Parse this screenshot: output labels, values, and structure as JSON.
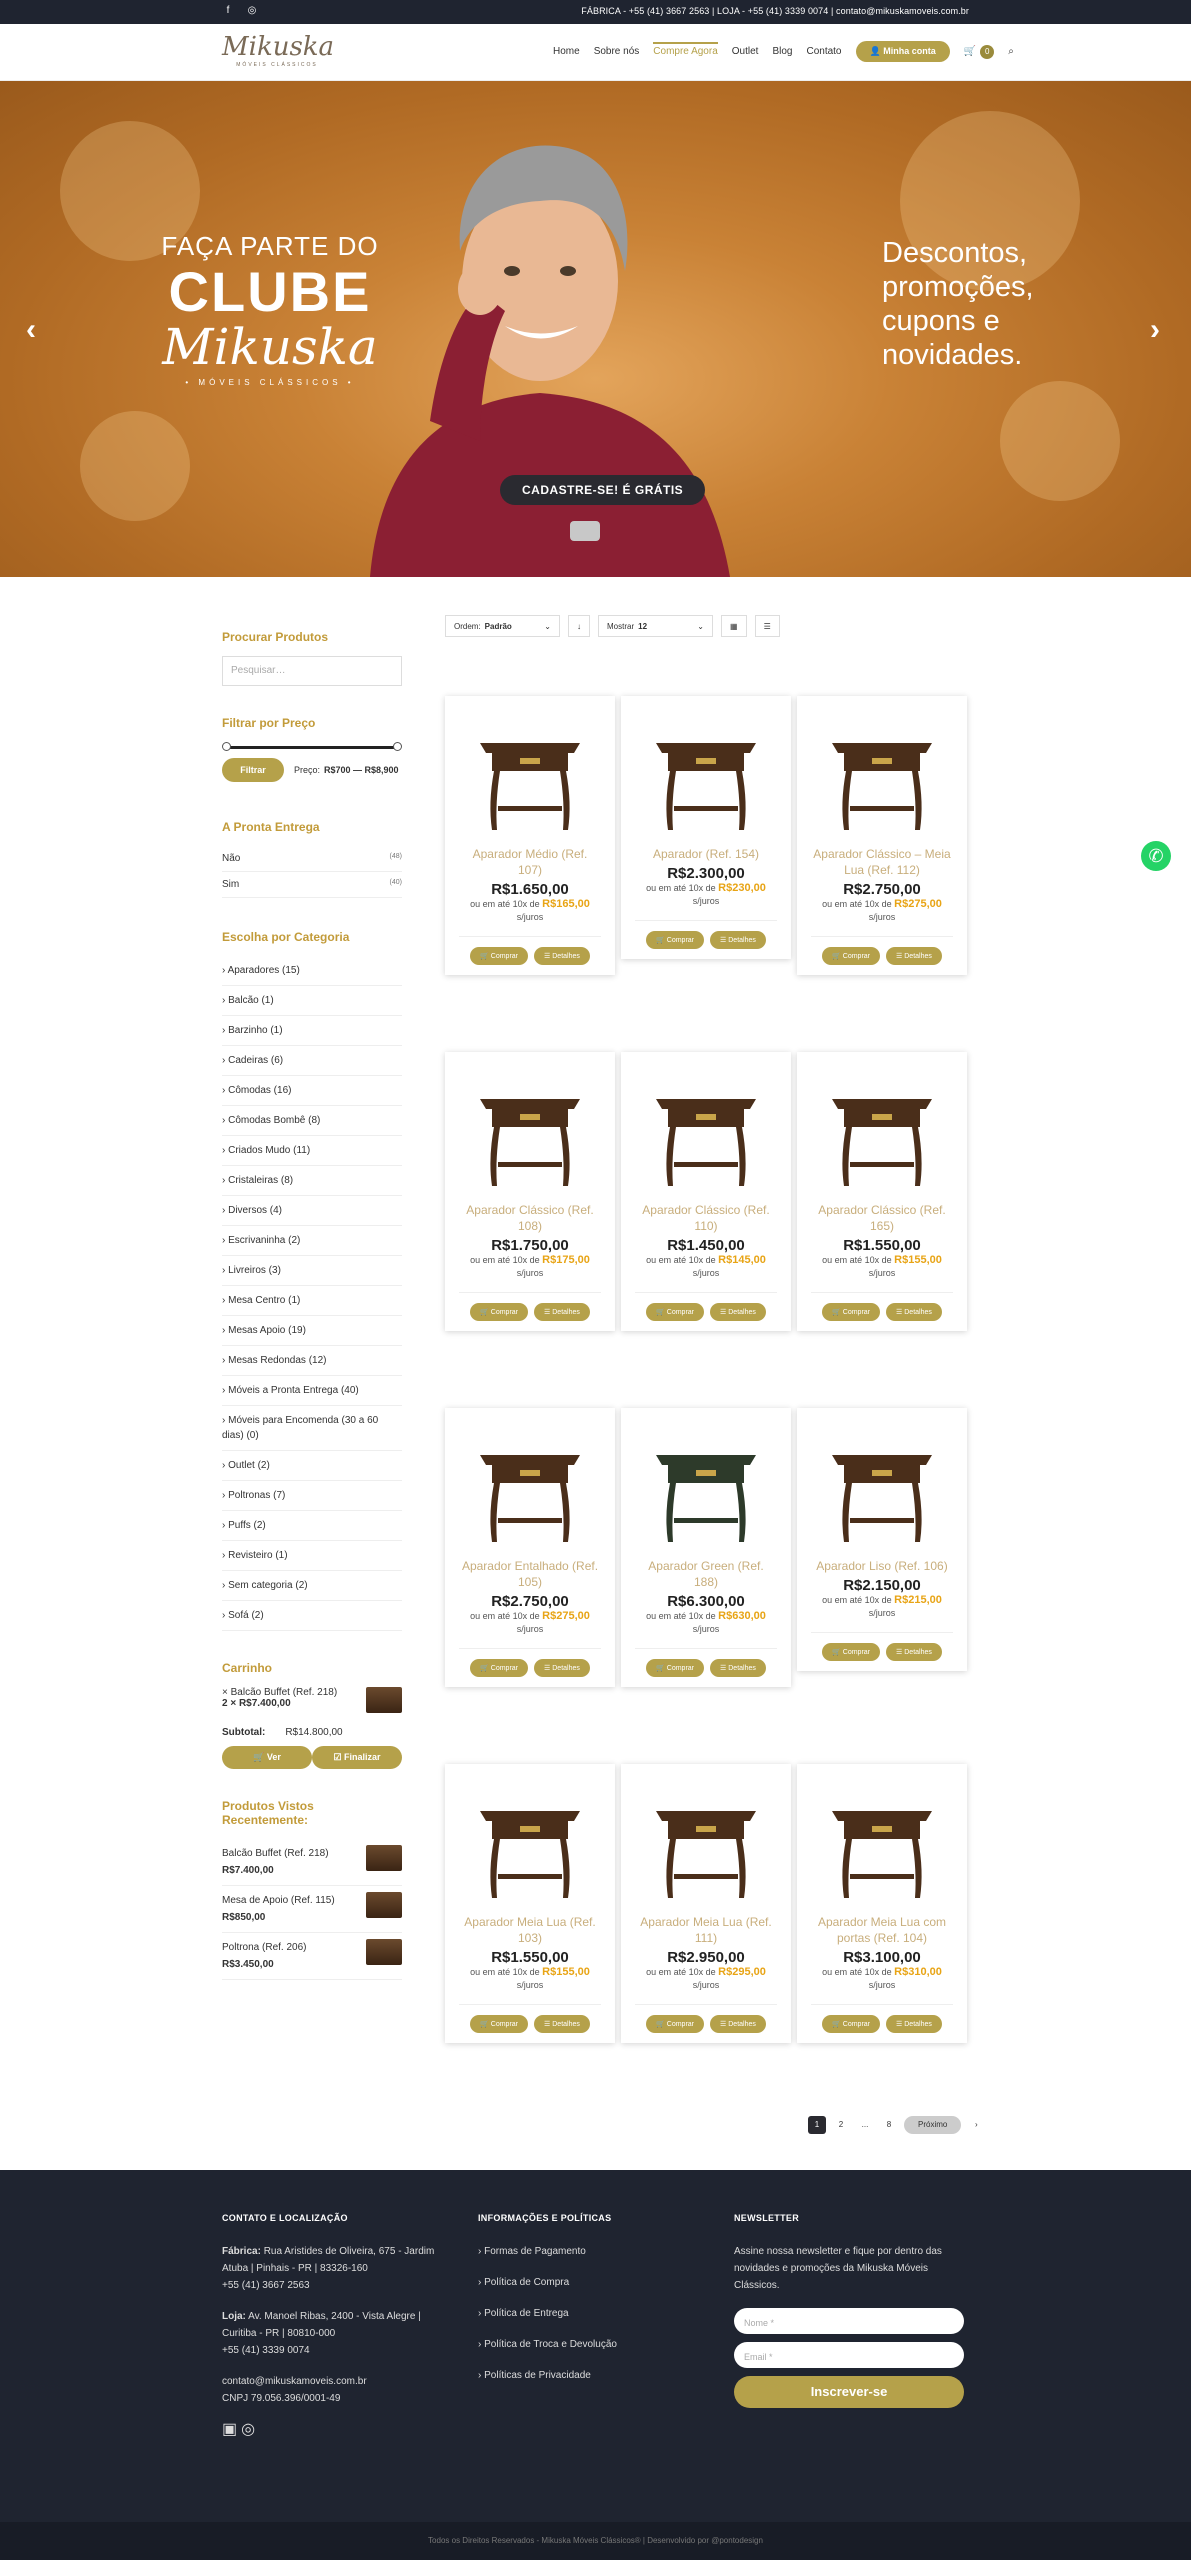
{
  "topbar": {
    "contact": "FÁBRICA - +55 (41) 3667 2563 | LOJA - +55 (41) 3339 0074 | contato@mikuskamoveis.com.br",
    "social": [
      "facebook-icon",
      "instagram-icon"
    ]
  },
  "header": {
    "logo": "Mikuska",
    "logo_sub": "MÓVEIS CLÁSSICOS",
    "nav": [
      "Home",
      "Sobre nós",
      "Compre Agora",
      "Outlet",
      "Blog",
      "Contato"
    ],
    "account": "Minha conta",
    "cart_count": "0"
  },
  "hero": {
    "line1": "FAÇA PARTE DO",
    "line2": "CLUBE",
    "line3": "Mikuska",
    "line4": "• MÓVEIS CLÁSSICOS •",
    "promo": [
      "Descontos,",
      "promoções,",
      "cupons e",
      "novidades."
    ],
    "cta_a": "CADASTRE-SE!",
    "cta_b": "É GRÁTIS"
  },
  "sidebar": {
    "search_title": "Procurar Produtos",
    "search_placeholder": "Pesquisar…",
    "price_title": "Filtrar por Preço",
    "filter_btn": "Filtrar",
    "price_label": "Preço:",
    "price_range": "R$700 — R$8,900",
    "ready_title": "A Pronta Entrega",
    "ready": [
      {
        "label": "Não",
        "count": "(48)"
      },
      {
        "label": "Sim",
        "count": "(40)"
      }
    ],
    "cat_title": "Escolha por Categoria",
    "categories": [
      "Aparadores (15)",
      "Balcão (1)",
      "Barzinho (1)",
      "Cadeiras (6)",
      "Cômodas (16)",
      "Cômodas Bombê (8)",
      "Criados Mudo (11)",
      "Cristaleiras (8)",
      "Diversos (4)",
      "Escrivaninha (2)",
      "Livreiros (3)",
      "Mesa Centro (1)",
      "Mesas Apoio (19)",
      "Mesas Redondas (12)",
      "Móveis a Pronta Entrega (40)",
      "Móveis para Encomenda (30 a 60 dias) (0)",
      "Outlet (2)",
      "Poltronas (7)",
      "Puffs (2)",
      "Revisteiro (1)",
      "Sem categoria (2)",
      "Sofá (2)"
    ],
    "cart_title": "Carrinho",
    "cart_item": "× Balcão Buffet (Ref. 218)",
    "cart_qty": "2 × R$7.400,00",
    "subtotal_label": "Subtotal:",
    "subtotal": "R$14.800,00",
    "btn_view": "Ver",
    "btn_finish": "Finalizar",
    "recent_title": "Produtos Vistos Recentemente:",
    "recent": [
      {
        "name": "Balcão Buffet (Ref. 218)",
        "price": "R$7.400,00"
      },
      {
        "name": "Mesa de Apoio (Ref. 115)",
        "price": "R$850,00"
      },
      {
        "name": "Poltrona (Ref. 206)",
        "price": "R$3.450,00"
      }
    ]
  },
  "toolbar": {
    "order_label": "Ordem:",
    "order": "Padrão",
    "show_label": "Mostrar",
    "show": "12"
  },
  "products": [
    {
      "name": "Aparador Médio (Ref. 107)",
      "price": "R$1.650,00",
      "inst": "R$165,00"
    },
    {
      "name": "Aparador (Ref. 154)",
      "price": "R$2.300,00",
      "inst": "R$230,00"
    },
    {
      "name": "Aparador Clássico – Meia Lua (Ref. 112)",
      "price": "R$2.750,00",
      "inst": "R$275,00"
    },
    {
      "name": "Aparador Clássico (Ref. 108)",
      "price": "R$1.750,00",
      "inst": "R$175,00"
    },
    {
      "name": "Aparador Clássico (Ref. 110)",
      "price": "R$1.450,00",
      "inst": "R$145,00"
    },
    {
      "name": "Aparador Clássico (Ref. 165)",
      "price": "R$1.550,00",
      "inst": "R$155,00"
    },
    {
      "name": "Aparador Entalhado (Ref. 105)",
      "price": "R$2.750,00",
      "inst": "R$275,00"
    },
    {
      "name": "Aparador Green (Ref. 188)",
      "price": "R$6.300,00",
      "inst": "R$630,00"
    },
    {
      "name": "Aparador Liso (Ref. 106)",
      "price": "R$2.150,00",
      "inst": "R$215,00"
    },
    {
      "name": "Aparador Meia Lua (Ref. 103)",
      "price": "R$1.550,00",
      "inst": "R$155,00"
    },
    {
      "name": "Aparador Meia Lua (Ref. 111)",
      "price": "R$2.950,00",
      "inst": "R$295,00"
    },
    {
      "name": "Aparador Meia Lua com portas (Ref. 104)",
      "price": "R$3.100,00",
      "inst": "R$310,00"
    }
  ],
  "card_text": {
    "inst_pre": "ou em até 10x de",
    "inst_post": "s/juros",
    "buy": "Comprar",
    "details": "Detalhes"
  },
  "pagination": [
    "1",
    "2",
    "...",
    "8",
    "Próximo",
    "›"
  ],
  "footer": {
    "col1_title": "CONTATO E LOCALIZAÇÃO",
    "factory_label": "Fábrica:",
    "factory": "Rua Aristides de Oliveira, 675 - Jardim Atuba | Pinhais - PR | 83326-160",
    "factory_phone": "+55 (41) 3667 2563",
    "store_label": "Loja:",
    "store": "Av. Manoel Ribas, 2400 - Vista Alegre | Curitiba - PR | 80810-000",
    "store_phone": "+55 (41) 3339 0074",
    "email": "contato@mikuskamoveis.com.br",
    "cnpj": "CNPJ 79.056.396/0001-49",
    "col2_title": "INFORMAÇÕES E POLÍTICAS",
    "links": [
      "Formas de Pagamento",
      "Política de Compra",
      "Política de Entrega",
      "Política de Troca e Devolução",
      "Políticas de Privacidade"
    ],
    "col3_title": "NEWSLETTER",
    "nl_text": "Assine nossa newsletter e fique por dentro das novidades e promoções da Mikuska Móveis Clássicos.",
    "nl_name": "Nome *",
    "nl_email": "Email *",
    "nl_btn": "Inscrever-se"
  },
  "copyright": "Todos os Direitos Reservados - Mikuska Móveis Clássicos® | Desenvolvido por @pontodesign"
}
